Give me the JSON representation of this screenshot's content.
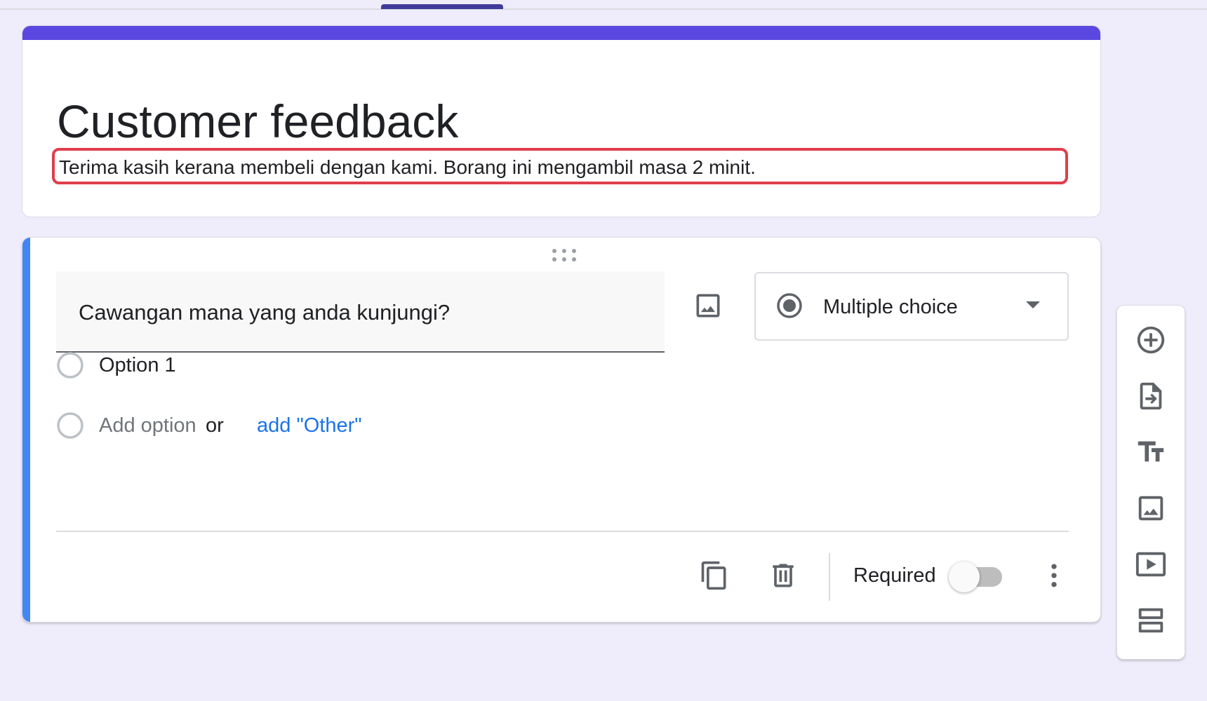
{
  "form": {
    "title": "Customer feedback",
    "description": "Terima kasih kerana membeli dengan kami. Borang ini mengambil masa 2 minit."
  },
  "question": {
    "title": "Cawangan mana yang anda kunjungi?",
    "type": "Multiple choice",
    "options": [
      {
        "label": "Option 1"
      }
    ],
    "add_option": "Add option",
    "or_text": "or",
    "add_other": "add \"Other\"",
    "required_label": "Required",
    "required": false
  },
  "icons": {
    "drag": "drag-handle-icon",
    "image": "image-icon",
    "type_radio": "radio-checked-icon",
    "dropdown": "caret-down-icon",
    "duplicate": "copy-icon",
    "delete": "trash-icon",
    "more": "more-vert-icon"
  },
  "toolbar": {
    "items": [
      {
        "name": "add-question",
        "icon": "add-circle-icon"
      },
      {
        "name": "import-questions",
        "icon": "import-file-icon"
      },
      {
        "name": "add-title-description",
        "icon": "text-format-icon"
      },
      {
        "name": "add-image",
        "icon": "image-icon"
      },
      {
        "name": "add-video",
        "icon": "video-icon"
      },
      {
        "name": "add-section",
        "icon": "section-icon"
      }
    ]
  },
  "colors": {
    "background": "#efecfb",
    "title_accent": "#5b48e0",
    "question_accent": "#4285f4",
    "highlight_border": "#e03e4c",
    "link": "#1a73e8",
    "tab_indicator": "#3f3c9b"
  }
}
